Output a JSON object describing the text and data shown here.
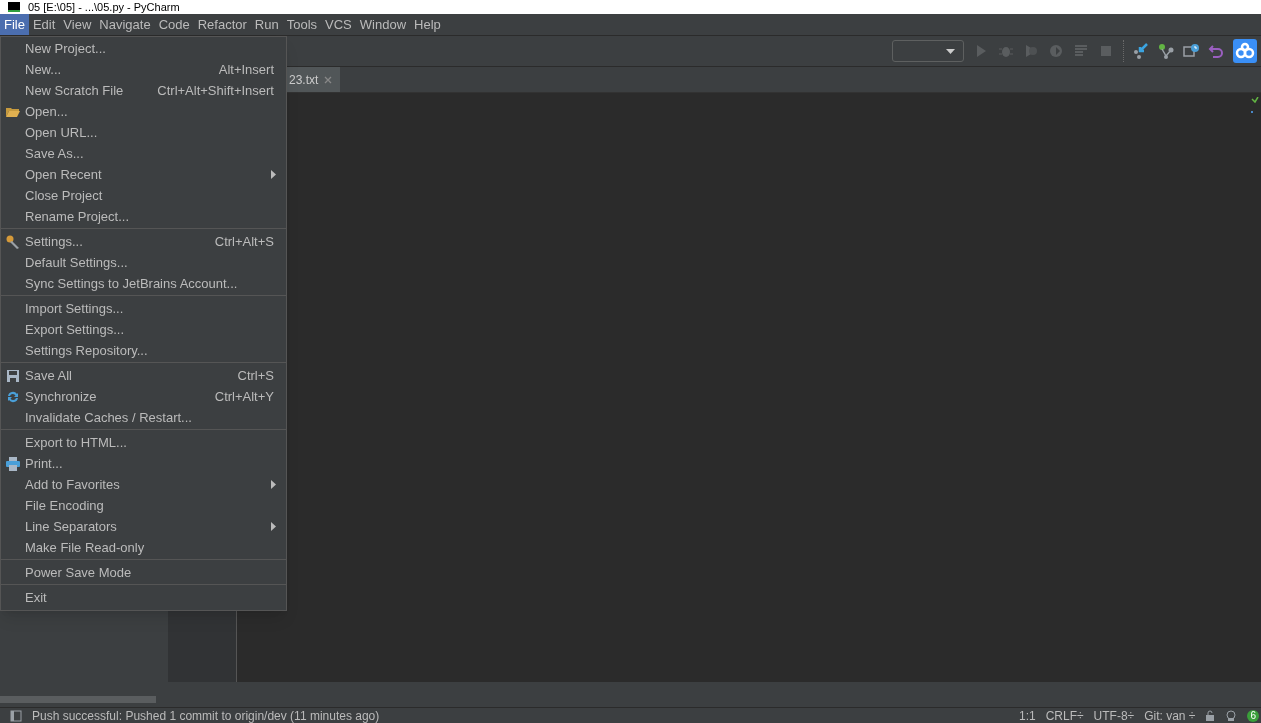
{
  "window": {
    "title": "05 [E:\\05] - ...\\05.py - PyCharm"
  },
  "menu_bar": [
    {
      "label": "File",
      "selected": true
    },
    {
      "label": "Edit",
      "selected": false
    },
    {
      "label": "View",
      "selected": false
    },
    {
      "label": "Navigate",
      "selected": false
    },
    {
      "label": "Code",
      "selected": false
    },
    {
      "label": "Refactor",
      "selected": false
    },
    {
      "label": "Run",
      "selected": false
    },
    {
      "label": "Tools",
      "selected": false
    },
    {
      "label": "VCS",
      "selected": false
    },
    {
      "label": "Window",
      "selected": false
    },
    {
      "label": "Help",
      "selected": false
    }
  ],
  "file_menu": [
    [
      {
        "label": "New Project...",
        "submenu": false
      },
      {
        "label": "New...",
        "shortcut": "Alt+Insert",
        "submenu": false
      },
      {
        "label": "New Scratch File",
        "shortcut": "Ctrl+Alt+Shift+Insert",
        "submenu": false
      },
      {
        "label": "Open...",
        "submenu": false
      },
      {
        "label": "Open URL...",
        "submenu": false
      },
      {
        "label": "Save As...",
        "submenu": false
      },
      {
        "label": "Open Recent",
        "submenu": true
      },
      {
        "label": "Close Project",
        "submenu": false
      },
      {
        "label": "Rename Project...",
        "submenu": false
      }
    ],
    [
      {
        "label": "Settings...",
        "shortcut": "Ctrl+Alt+S",
        "submenu": false
      },
      {
        "label": "Default Settings...",
        "submenu": false
      },
      {
        "label": "Sync Settings to JetBrains Account...",
        "submenu": false
      }
    ],
    [
      {
        "label": "Import Settings...",
        "submenu": false
      },
      {
        "label": "Export Settings...",
        "submenu": false
      },
      {
        "label": "Settings Repository...",
        "submenu": false
      }
    ],
    [
      {
        "label": "Save All",
        "shortcut": "Ctrl+S",
        "submenu": false
      },
      {
        "label": "Synchronize",
        "shortcut": "Ctrl+Alt+Y",
        "submenu": false
      },
      {
        "label": "Invalidate Caches / Restart...",
        "submenu": false
      }
    ],
    [
      {
        "label": "Export to HTML...",
        "submenu": false
      },
      {
        "label": "Print...",
        "submenu": false
      },
      {
        "label": "Add to Favorites",
        "submenu": true
      },
      {
        "label": "File Encoding",
        "submenu": false
      },
      {
        "label": "Line Separators",
        "submenu": true
      },
      {
        "label": "Make File Read-only",
        "submenu": false
      }
    ],
    [
      {
        "label": "Power Save Mode",
        "submenu": false
      }
    ],
    [
      {
        "label": "Exit",
        "submenu": false
      }
    ]
  ],
  "editor_tab": {
    "label": "23.txt"
  },
  "status_bar": {
    "message": "Push successful: Pushed 1 commit to origin/dev (11 minutes ago)",
    "position": "1:1",
    "line_separator": "CRLF÷",
    "encoding": "UTF-8÷",
    "vcs": "Git: van ÷",
    "badge": "6"
  }
}
